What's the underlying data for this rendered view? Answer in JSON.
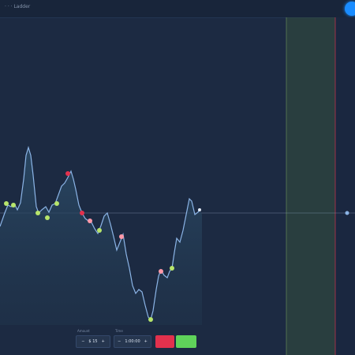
{
  "app": {
    "title": "· · · Ladder"
  },
  "trade_panel": {
    "amount_label": "Amount",
    "amount_value": "$ 15",
    "time_label": "Time",
    "time_value": "1:00:00",
    "down_button_label": "",
    "up_button_label": "",
    "down_color": "#e2314d",
    "up_color": "#5fd35a"
  },
  "icons": {
    "avatar": "user-avatar-icon",
    "minus": "minus-icon",
    "plus": "plus-icon"
  },
  "colors": {
    "background": "#1c2a42",
    "price_line": "#8bb4e6",
    "area_fill": "#2a4a66",
    "expiry_zone": "#3a5a3a",
    "expiry_line": "#e2314d"
  }
}
